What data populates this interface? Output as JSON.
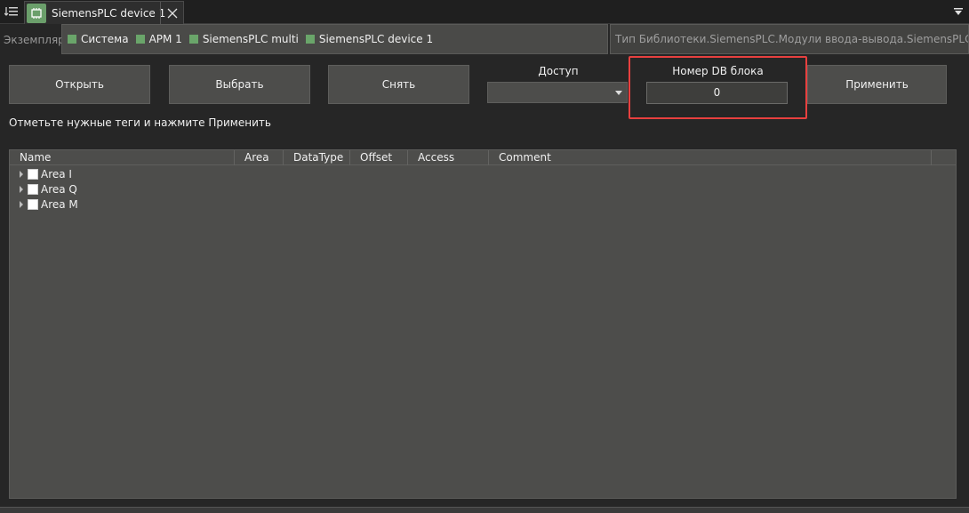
{
  "tab": {
    "label": "SiemensPLC device 1"
  },
  "breadcrumb": {
    "prefix": "Экземпляр",
    "items": [
      {
        "label": "Система"
      },
      {
        "label": "АРМ 1"
      },
      {
        "label": "SiemensPLC multi"
      },
      {
        "label": "SiemensPLC device 1"
      }
    ],
    "square_color": "#6aa56a"
  },
  "library_type": "Тип Библиотеки.SiemensPLC.Модули ввода-вывода.SiemensPLC device",
  "toolbar": {
    "open_label": "Открыть",
    "select_label": "Выбрать",
    "clear_label": "Снять",
    "access_label": "Доступ",
    "access_value": "",
    "db_label": "Номер DB блока",
    "db_value": "0",
    "apply_label": "Применить"
  },
  "hint": "Отметьте нужные теги и нажмите Применить",
  "table": {
    "columns": [
      "Name",
      "Area",
      "DataType",
      "Offset",
      "Access",
      "Comment"
    ],
    "rows": [
      {
        "label": "Area I",
        "checked": false
      },
      {
        "label": "Area Q",
        "checked": false
      },
      {
        "label": "Area M",
        "checked": false
      }
    ]
  },
  "colors": {
    "highlight": "#e8403f",
    "panel": "#4d4d4b"
  },
  "icons": {
    "tab_menu": "list-menu-icon",
    "tab": "plc-device-icon",
    "close": "close-icon",
    "overflow": "chevron-down-icon"
  }
}
